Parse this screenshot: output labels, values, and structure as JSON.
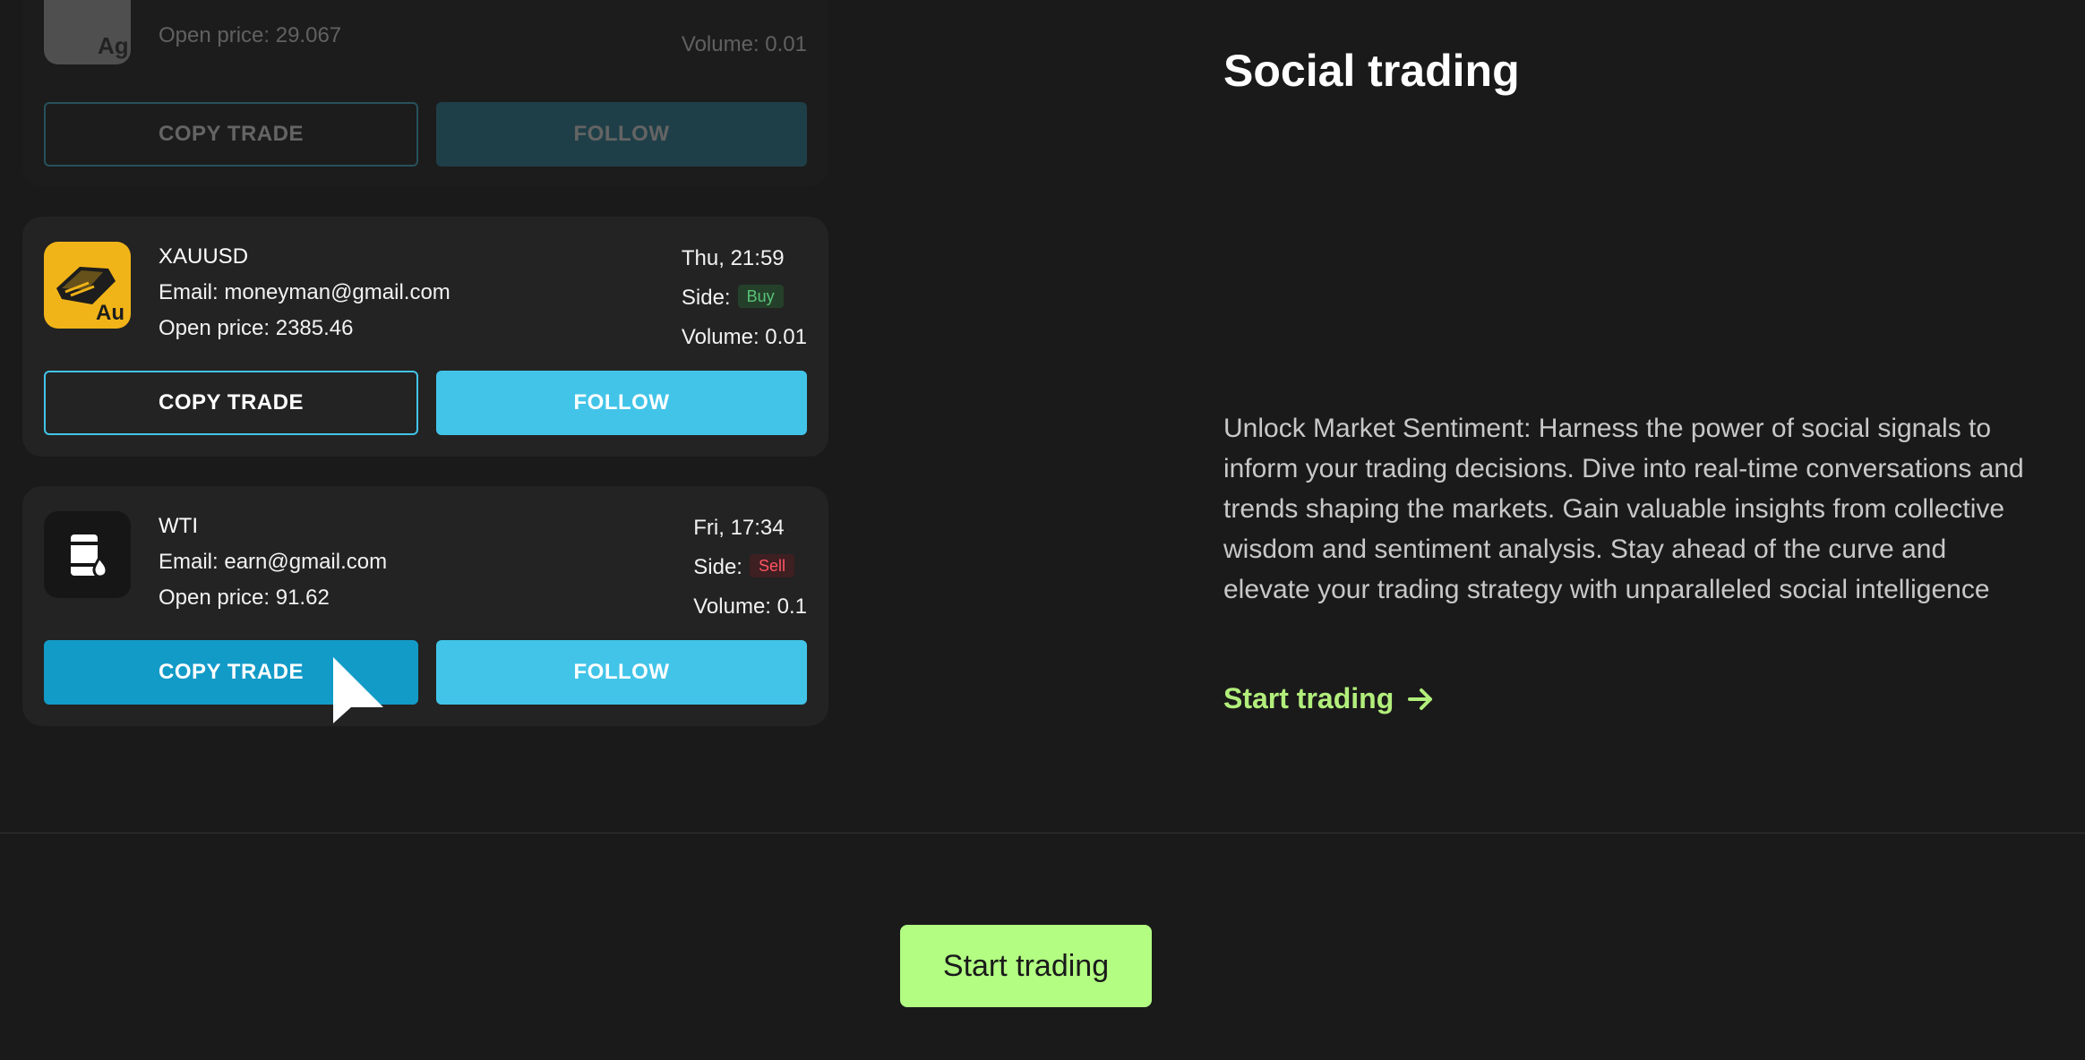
{
  "trades": [
    {
      "symbol": "",
      "email": "",
      "open_price": "Open price: 29.067",
      "date": "",
      "side_label": "",
      "side": "",
      "volume": "Volume: 0.01",
      "copy_label": "COPY TRADE",
      "follow_label": "FOLLOW",
      "icon": "silver-icon",
      "icon_text": "Ag"
    },
    {
      "symbol": "XAUUSD",
      "email": "Email: moneyman@gmail.com",
      "open_price": "Open price: 2385.46",
      "date": "Thu, 21:59",
      "side_label": "Side:",
      "side": "Buy",
      "volume": "Volume: 0.01",
      "copy_label": "COPY TRADE",
      "follow_label": "FOLLOW",
      "icon": "gold-bar-icon",
      "icon_text": "Au"
    },
    {
      "symbol": "WTI",
      "email": "Email: earn@gmail.com",
      "open_price": "Open price: 91.62",
      "date": "Fri, 17:34",
      "side_label": "Side:",
      "side": "Sell",
      "volume": "Volume: 0.1",
      "copy_label": "COPY TRADE",
      "follow_label": "FOLLOW",
      "icon": "oil-barrel-icon"
    }
  ],
  "section": {
    "title": "Social trading",
    "description": "Unlock Market Sentiment: Harness the power of social signals to inform your trading decisions. Dive into real-time conversations and trends shaping the markets. Gain valuable insights from collective wisdom and sentiment analysis. Stay ahead of the curve and elevate your trading strategy with unparalleled social intelligence",
    "link_label": "Start trading",
    "link_icon": "arrow-right-icon"
  },
  "footer": {
    "cta_label": "Start trading"
  },
  "colors": {
    "background": "#1a1a1a",
    "card": "#232323",
    "accent_blue": "#42c4e8",
    "accent_blue_active": "#139bc8",
    "accent_green": "#b2fd82",
    "buy": "#58c478",
    "sell": "#ff5563"
  }
}
